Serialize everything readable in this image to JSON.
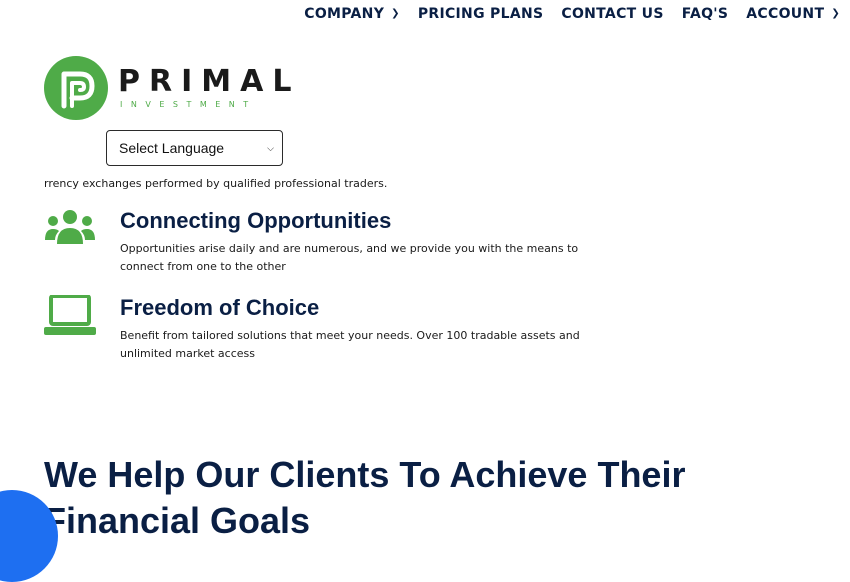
{
  "nav": {
    "items": [
      {
        "label": "COMPANY",
        "has_dropdown": true
      },
      {
        "label": "PRICING PLANS",
        "has_dropdown": false
      },
      {
        "label": "CONTACT US",
        "has_dropdown": false
      },
      {
        "label": "FAQ'S",
        "has_dropdown": false
      },
      {
        "label": "ACCOUNT",
        "has_dropdown": true
      }
    ]
  },
  "logo": {
    "word": "PRIMAL",
    "subword": "INVESTMENT",
    "color_brand": "#4fab48"
  },
  "language": {
    "selected": "Select Language"
  },
  "intro_text": "rrency exchanges performed by qualified professional traders.",
  "features": [
    {
      "icon": "users-group-icon",
      "title": "Connecting Opportunities",
      "description": "Opportunities arise daily and are numerous, and we provide you with the means to connect from one to the other"
    },
    {
      "icon": "laptop-icon",
      "title": "Freedom of Choice",
      "description": "Benefit from tailored solutions that meet your needs. Over 100 tradable assets and unlimited market access"
    }
  ],
  "heading": "We Help Our Clients To Achieve Their Financial Goals",
  "colors": {
    "accent_green": "#4fab48",
    "heading_navy": "#0a1f44",
    "chat_blue": "#1e6ff1"
  }
}
